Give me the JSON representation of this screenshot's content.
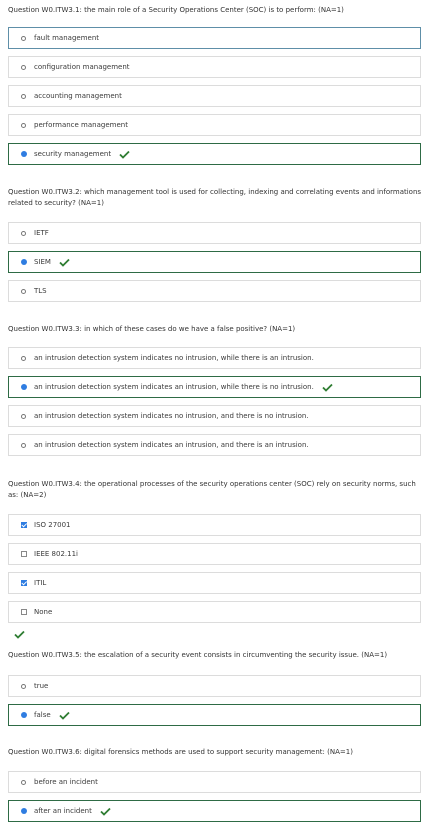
{
  "questions": [
    {
      "text": "Question W0.ITW3.1: the main role of a Security Operations Center (SOC) is to perform: (NA=1)",
      "type": "radio",
      "options": [
        {
          "label": "fault management",
          "selected": false
        },
        {
          "label": "configuration management",
          "selected": false
        },
        {
          "label": "accounting management",
          "selected": false
        },
        {
          "label": "performance management",
          "selected": false
        },
        {
          "label": "security management",
          "selected": true,
          "correct": true
        }
      ]
    },
    {
      "text": "Question W0.ITW3.2: which management tool is used for collecting, indexing and correlating events and informations related to security? (NA=1)",
      "type": "radio",
      "options": [
        {
          "label": "IETF",
          "selected": false
        },
        {
          "label": "SIEM",
          "selected": true,
          "correct": true
        },
        {
          "label": "TLS",
          "selected": false
        }
      ]
    },
    {
      "text": "Question W0.ITW3.3: in which of these cases do we have a false positive? (NA=1)",
      "type": "radio",
      "options": [
        {
          "label": "an intrusion detection system indicates no intrusion, while there is an intrusion.",
          "selected": false
        },
        {
          "label": "an intrusion detection system indicates an intrusion, while there is no intrusion.",
          "selected": true,
          "correct": true
        },
        {
          "label": "an intrusion detection system indicates no intrusion, and there is no intrusion.",
          "selected": false
        },
        {
          "label": "an intrusion detection system indicates an intrusion, and there is an intrusion.",
          "selected": false
        }
      ]
    },
    {
      "text": "Question W0.ITW3.4: the operational processes of the security operations center (SOC) rely on security norms, such as: (NA=2)",
      "type": "checkbox",
      "question_correct": true,
      "options": [
        {
          "label": "ISO 27001",
          "selected": true
        },
        {
          "label": "IEEE 802.11i",
          "selected": false
        },
        {
          "label": "ITIL",
          "selected": true
        },
        {
          "label": "None",
          "selected": false
        }
      ]
    },
    {
      "text": "Question W0.ITW3.5: the escalation of a security event consists in circumventing the security issue. (NA=1)",
      "type": "radio",
      "options": [
        {
          "label": "true",
          "selected": false
        },
        {
          "label": "false",
          "selected": true,
          "correct": true
        }
      ]
    },
    {
      "text": "Question W0.ITW3.6: digital forensics methods are used to support security management: (NA=1)",
      "type": "radio",
      "options": [
        {
          "label": "before an incident",
          "selected": false
        },
        {
          "label": "after an incident",
          "selected": true,
          "correct": true
        }
      ]
    }
  ],
  "icons": {
    "correct": "checkmark-icon"
  },
  "colors": {
    "correct": "#2e7d32",
    "selected_border": "#2e6b45",
    "focused_border": "#5e8fa8",
    "accent": "#2f7de1"
  }
}
